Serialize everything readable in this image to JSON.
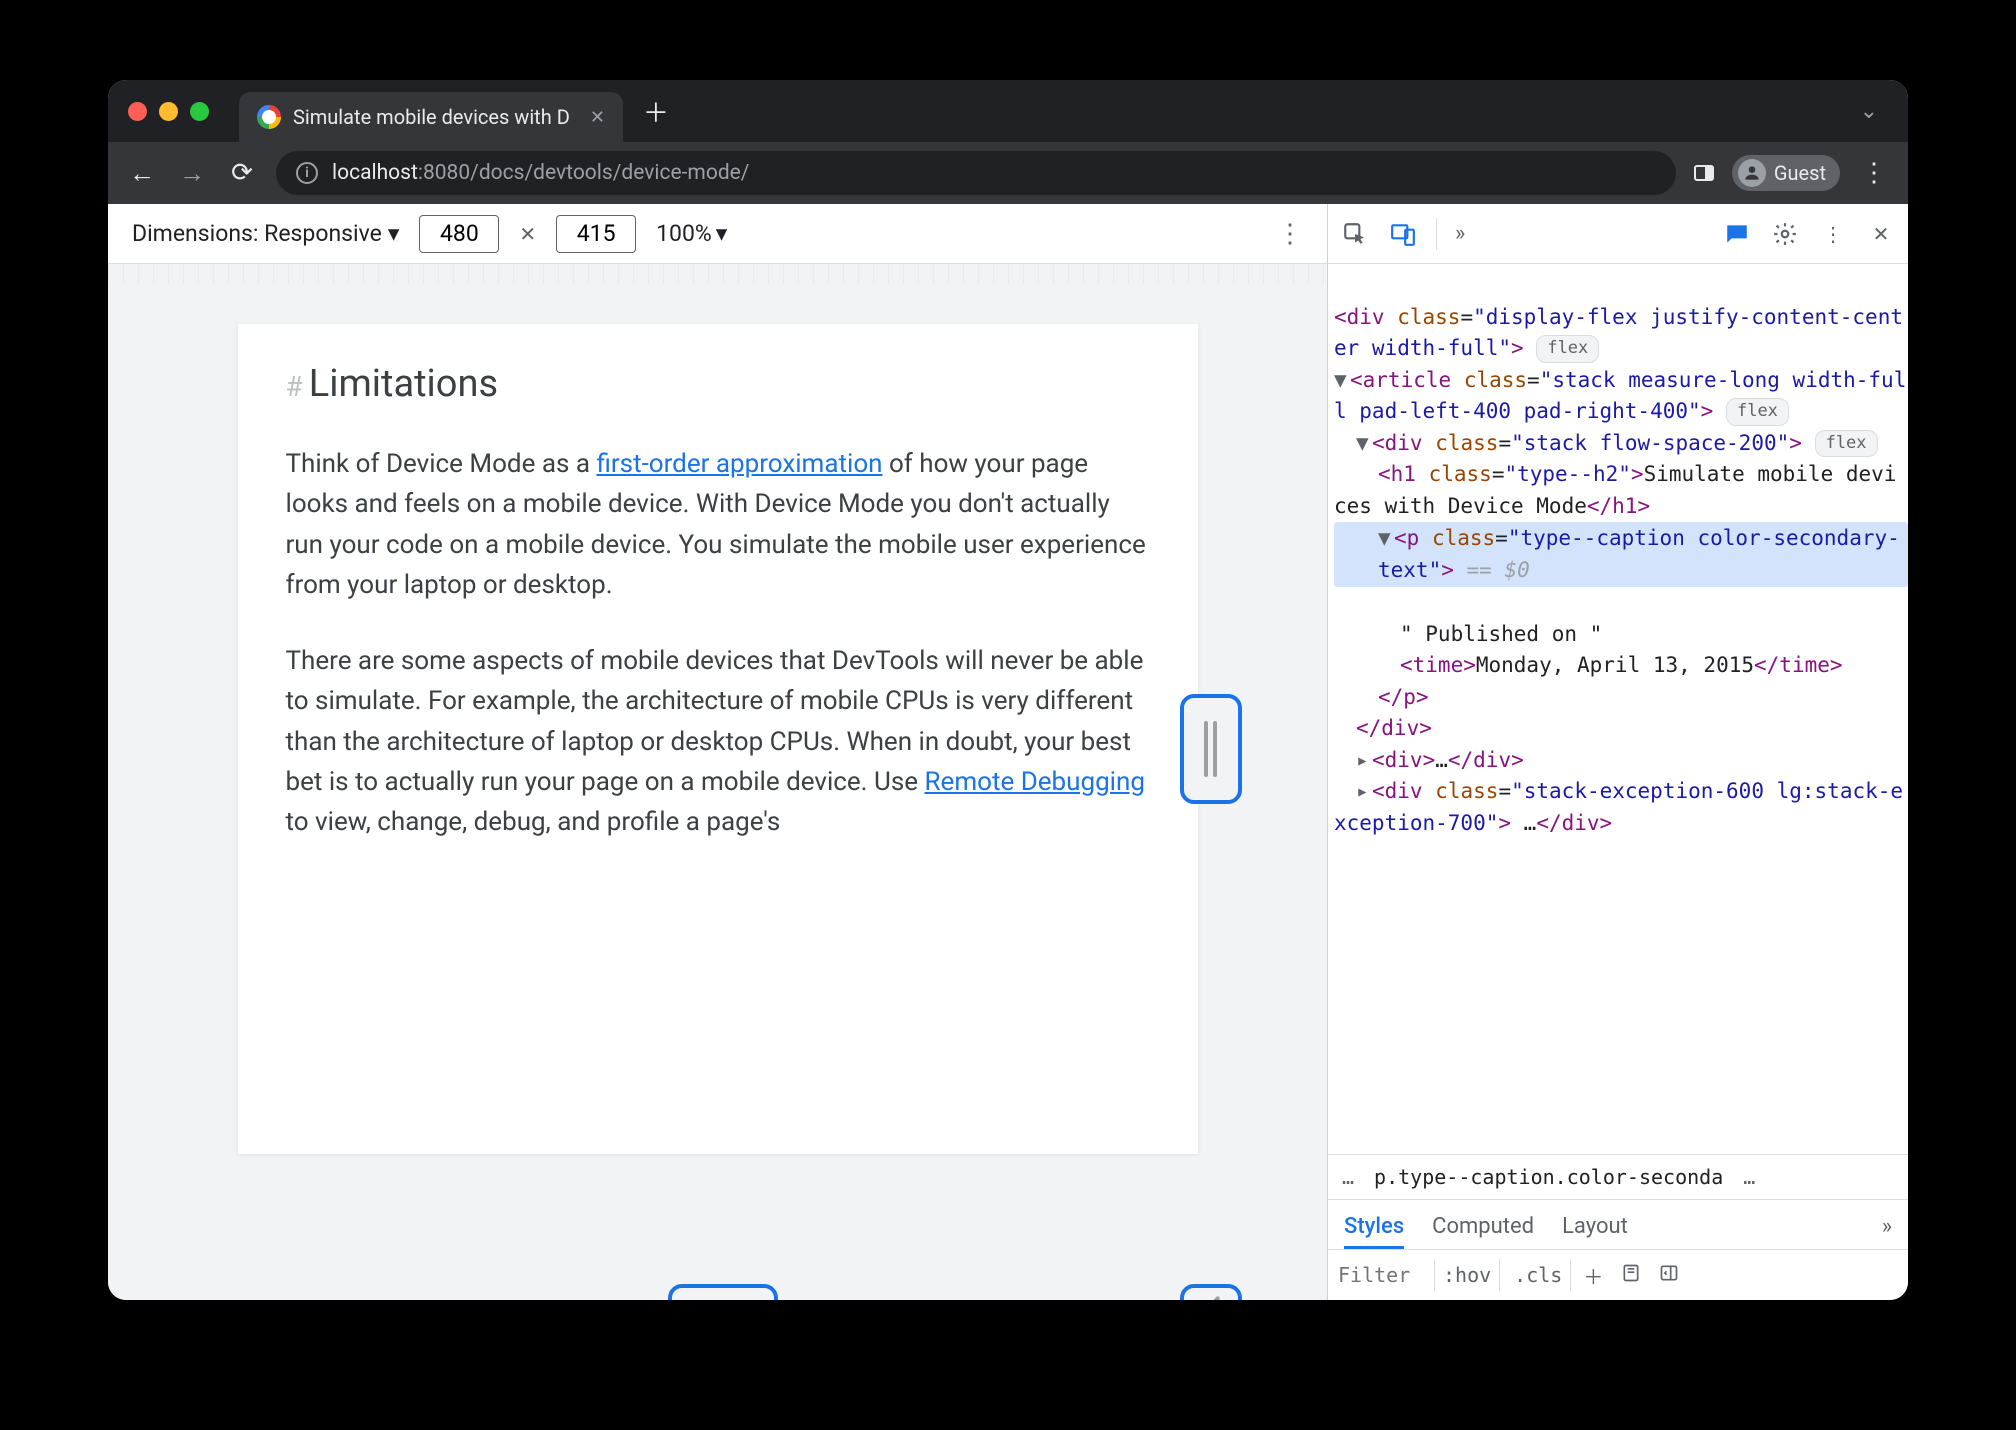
{
  "tab": {
    "title": "Simulate mobile devices with D"
  },
  "url": {
    "host": "localhost",
    "rest": ":8080/docs/devtools/device-mode/"
  },
  "profile": {
    "label": "Guest"
  },
  "device_toolbar": {
    "dimensions_label": "Dimensions: Responsive",
    "width": "480",
    "height": "415",
    "zoom": "100%"
  },
  "doc": {
    "heading": "Limitations",
    "p1_a": "Think of Device Mode as a ",
    "p1_link": "first-order approximation",
    "p1_b": " of how your page looks and feels on a mobile device. With Device Mode you don't actually run your code on a mobile device. You simulate the mobile user experience from your laptop or desktop.",
    "p2_a": "There are some aspects of mobile devices that DevTools will never be able to simulate. For example, the architecture of mobile CPUs is very different than the architecture of laptop or desktop CPUs. When in doubt, your best bet is to actually run your page on a mobile device. Use ",
    "p2_link": "Remote Debugging",
    "p2_b": " to view, change, debug, and profile a page's"
  },
  "elements": {
    "l1": "<div class=\"display-flex justify-content-center width-full\">",
    "flex": "flex",
    "l2_open": "<article class=\"stack measure-long width-full pad-left-400 pad-right-400\">",
    "l3_open": "<div class=\"stack flow-space-200\">",
    "l4_h1_open": "<h1 class=\"type--h2\">",
    "l4_h1_text": "Simulate mobile devices with Device Mode",
    "l4_h1_close": "</h1>",
    "l5_p_open": "<p class=\"type--caption color-secondary-text\">",
    "eq0": " == $0",
    "l6_text": "\" Published on \"",
    "l7_time_open": "<time>",
    "l7_time_text": "Monday, April 13, 2015",
    "l7_time_close": "</time>",
    "l8_p_close": "</p>",
    "l9_div_close": "</div>",
    "l10": "<div>…</div>",
    "l11_open": "<div class=\"stack-exception-600 lg:stack-exception-700\">",
    "l11_cont": " …</div>"
  },
  "breadcrumb": {
    "left": "…",
    "sel": "p.type--caption.color-seconda",
    "right": "…"
  },
  "styles_tabs": {
    "styles": "Styles",
    "computed": "Computed",
    "layout": "Layout"
  },
  "styles_bar": {
    "filter_placeholder": "Filter",
    "hov": ":hov",
    "cls": ".cls"
  }
}
